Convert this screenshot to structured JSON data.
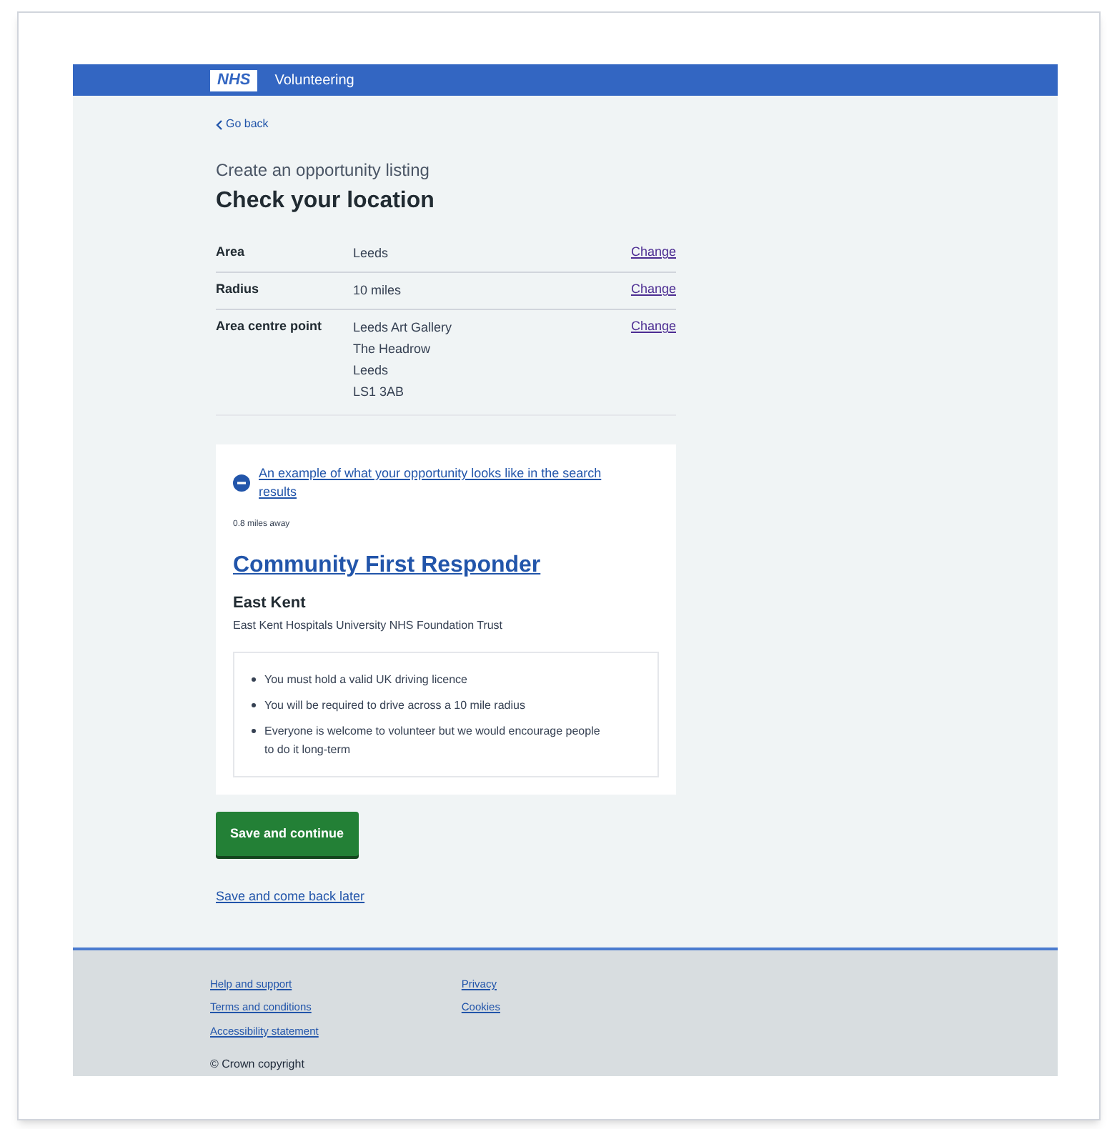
{
  "header": {
    "logo": "NHS",
    "service": "Volunteering"
  },
  "back_link": "Go back",
  "caption": "Create an opportunity listing",
  "heading": "Check your location",
  "summary": [
    {
      "key": "Area",
      "value": [
        "Leeds"
      ],
      "action": "Change"
    },
    {
      "key": "Radius",
      "value": [
        "10 miles"
      ],
      "action": "Change"
    },
    {
      "key": "Area centre point",
      "value": [
        "Leeds Art Gallery",
        "The Headrow",
        "Leeds",
        "LS1 3AB"
      ],
      "action": "Change"
    }
  ],
  "preview": {
    "expanded": true,
    "toggle": "An example of what your opportunity looks like in the search results",
    "distance": "0.8 miles away",
    "title": "Community First Responder",
    "location": "East Kent",
    "organisation": "East Kent Hospitals University NHS Foundation Trust",
    "requirements": [
      "You must hold a valid UK driving licence",
      "You will be required to drive across a 10 mile radius",
      "Everyone is welcome to volunteer but we would encourage people to do it long-term"
    ]
  },
  "primary_button": "Save and continue",
  "secondary_link": "Save and come back later",
  "footer": {
    "columns": [
      [
        "Help and support",
        "Terms and conditions",
        "Accessibility statement"
      ],
      [
        "Privacy",
        "Cookies"
      ]
    ],
    "copyright": "© Crown copyright"
  }
}
